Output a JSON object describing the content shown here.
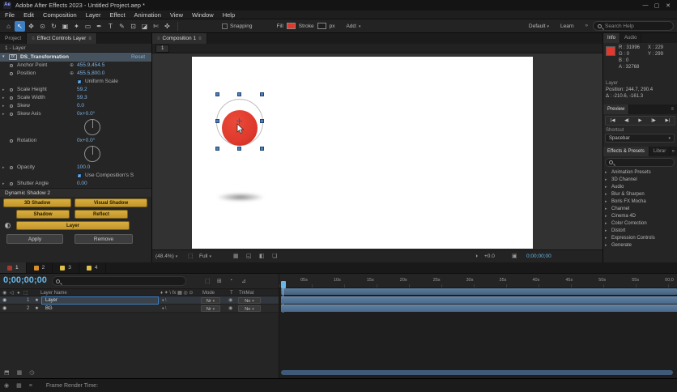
{
  "colors": {
    "accent": "#3e7fc1",
    "value-blue": "#7fb0e0",
    "timecode-cyan": "#67b7e8",
    "button-yellow": "#d9ad3e",
    "red": "#df3a2d",
    "bar-blue": "#4a6a8c",
    "tab1-red": "#a33a30",
    "tab2-orange": "#d98e2b",
    "tab3-yellow": "#dfc04a",
    "tab4-yellow": "#dfc04a"
  },
  "window": {
    "icon": "Ae",
    "title": "Adobe After Effects 2023 - Untitled Project.aep *",
    "minimize": "—",
    "maximize": "▢",
    "close": "✕"
  },
  "menubar": {
    "items": [
      "File",
      "Edit",
      "Composition",
      "Layer",
      "Effect",
      "Animation",
      "View",
      "Window",
      "Help"
    ]
  },
  "toolbar": {
    "tools": [
      {
        "name": "home-icon",
        "glyph": "⌂"
      },
      {
        "name": "selection-tool-icon",
        "glyph": "↖",
        "active": true
      },
      {
        "name": "hand-tool-icon",
        "glyph": "✥"
      },
      {
        "name": "zoom-tool-icon",
        "glyph": "⊙"
      },
      {
        "name": "orbit-camera-tool-icon",
        "glyph": "↻"
      },
      {
        "name": "camera-tool-icon",
        "glyph": "▣"
      },
      {
        "name": "pan-behind-tool-icon",
        "glyph": "✦"
      },
      {
        "name": "shape-tool-icon",
        "glyph": "▭"
      },
      {
        "name": "pen-tool-icon",
        "glyph": "✒"
      },
      {
        "name": "type-tool-icon",
        "glyph": "T"
      },
      {
        "name": "brush-tool-icon",
        "glyph": "✎"
      },
      {
        "name": "clone-stamp-tool-icon",
        "glyph": "⊡"
      },
      {
        "name": "eraser-tool-icon",
        "glyph": "◪"
      },
      {
        "name": "roto-brush-tool-icon",
        "glyph": "✄"
      },
      {
        "name": "puppet-pin-tool-icon",
        "glyph": "✜"
      }
    ],
    "snapping": "Snapping",
    "fill": "Fill",
    "stroke": "Stroke",
    "px": "px",
    "add": "Add:",
    "workspace": "Default",
    "learn": "Learn",
    "search_placeholder": "Search Help"
  },
  "effect_controls": {
    "tab_project": "Project",
    "tab_active": "Effect Controls Layer",
    "layer_header": "1 - Layer",
    "effect_name": "DS_Transformation",
    "reset": "Reset",
    "rows": [
      {
        "label": "Anchor Point",
        "value": "455.9,454.5"
      },
      {
        "label": "Position",
        "value": "455.5,800.0"
      },
      {
        "label": "Uniform Scale"
      },
      {
        "label": "Scale Height",
        "value": "59.2"
      },
      {
        "label": "Scale Width",
        "value": "59.3"
      },
      {
        "label": "Skew",
        "value": "0.0"
      },
      {
        "label": "Skew Axis",
        "value": "0x+0.0°"
      },
      {
        "label": "Rotation",
        "value": "0x+0.0°"
      },
      {
        "label": "Opacity",
        "value": "100.0"
      },
      {
        "label": "Use Composition's S"
      },
      {
        "label": "Shutter Angle",
        "value": "0.00"
      }
    ],
    "shadow_title": "Dynamic Shadow 2",
    "buttons": {
      "b3d": "3D Shadow",
      "visual": "Visual Shadow",
      "shadow": "Shadow",
      "reflect": "Reflect",
      "layer": "Layer",
      "apply": "Apply",
      "remove": "Remove"
    }
  },
  "composition": {
    "tab": "Composition 1",
    "mini_tab": "1",
    "zoom": "(48.4%)",
    "resolution": "Full",
    "exposure": "+0.0",
    "timecode": "0;00;00;00"
  },
  "info": {
    "tab": "Info",
    "tab_audio": "Audio",
    "r": "R : 31996",
    "g": "G : 0",
    "b": "B : 0",
    "a": "A : 32768",
    "x": "X : 229",
    "y": "Y : 299",
    "layer_label": "Layer",
    "position": "Position: 244.7, 290.4",
    "delta": "Δ : -210.6, -161.3"
  },
  "preview": {
    "tab": "Preview",
    "transport": [
      {
        "name": "first-frame-button",
        "glyph": "|◀"
      },
      {
        "name": "prev-frame-button",
        "glyph": "◀|"
      },
      {
        "name": "play-button",
        "glyph": "▶"
      },
      {
        "name": "next-frame-button",
        "glyph": "|▶"
      },
      {
        "name": "last-frame-button",
        "glyph": "▶|"
      }
    ],
    "shortcut_label": "Shortcut",
    "shortcut_value": "Spacebar"
  },
  "effects_presets": {
    "tab": "Effects & Presets",
    "tab_libraries": "Librar",
    "overflow": "»",
    "categories": [
      "Animation Presets",
      "3D Channel",
      "Audio",
      "Blur & Sharpen",
      "Boris FX Mocha",
      "Channel",
      "Cinema 4D",
      "Color Correction",
      "Distort",
      "Expression Controls",
      "Generate"
    ]
  },
  "timeline": {
    "tabs": [
      {
        "label": "1",
        "active": true
      },
      {
        "label": "2"
      },
      {
        "label": "3"
      },
      {
        "label": "4"
      }
    ],
    "timecode": "0;00;00;00",
    "columns": {
      "layer_name": "Layer Name",
      "mode": "Mode",
      "t": "T",
      "trkmat": "TrkMat"
    },
    "switch_icons": "♦ ✦ \\ fx ▦ ◎ ⊙",
    "layers": [
      {
        "index": "1",
        "name": "Layer",
        "mode": "Nr",
        "trkmat": "No"
      },
      {
        "index": "2",
        "name": "BG",
        "mode": "Nr",
        "trkmat": "No"
      }
    ],
    "ruler": [
      "05s",
      "10s",
      "15s",
      "20s",
      "25s",
      "30s",
      "35s",
      "40s",
      "45s",
      "50s",
      "55s",
      "00;0"
    ]
  },
  "statusbar": {
    "render_label": "Frame Render Time:"
  }
}
